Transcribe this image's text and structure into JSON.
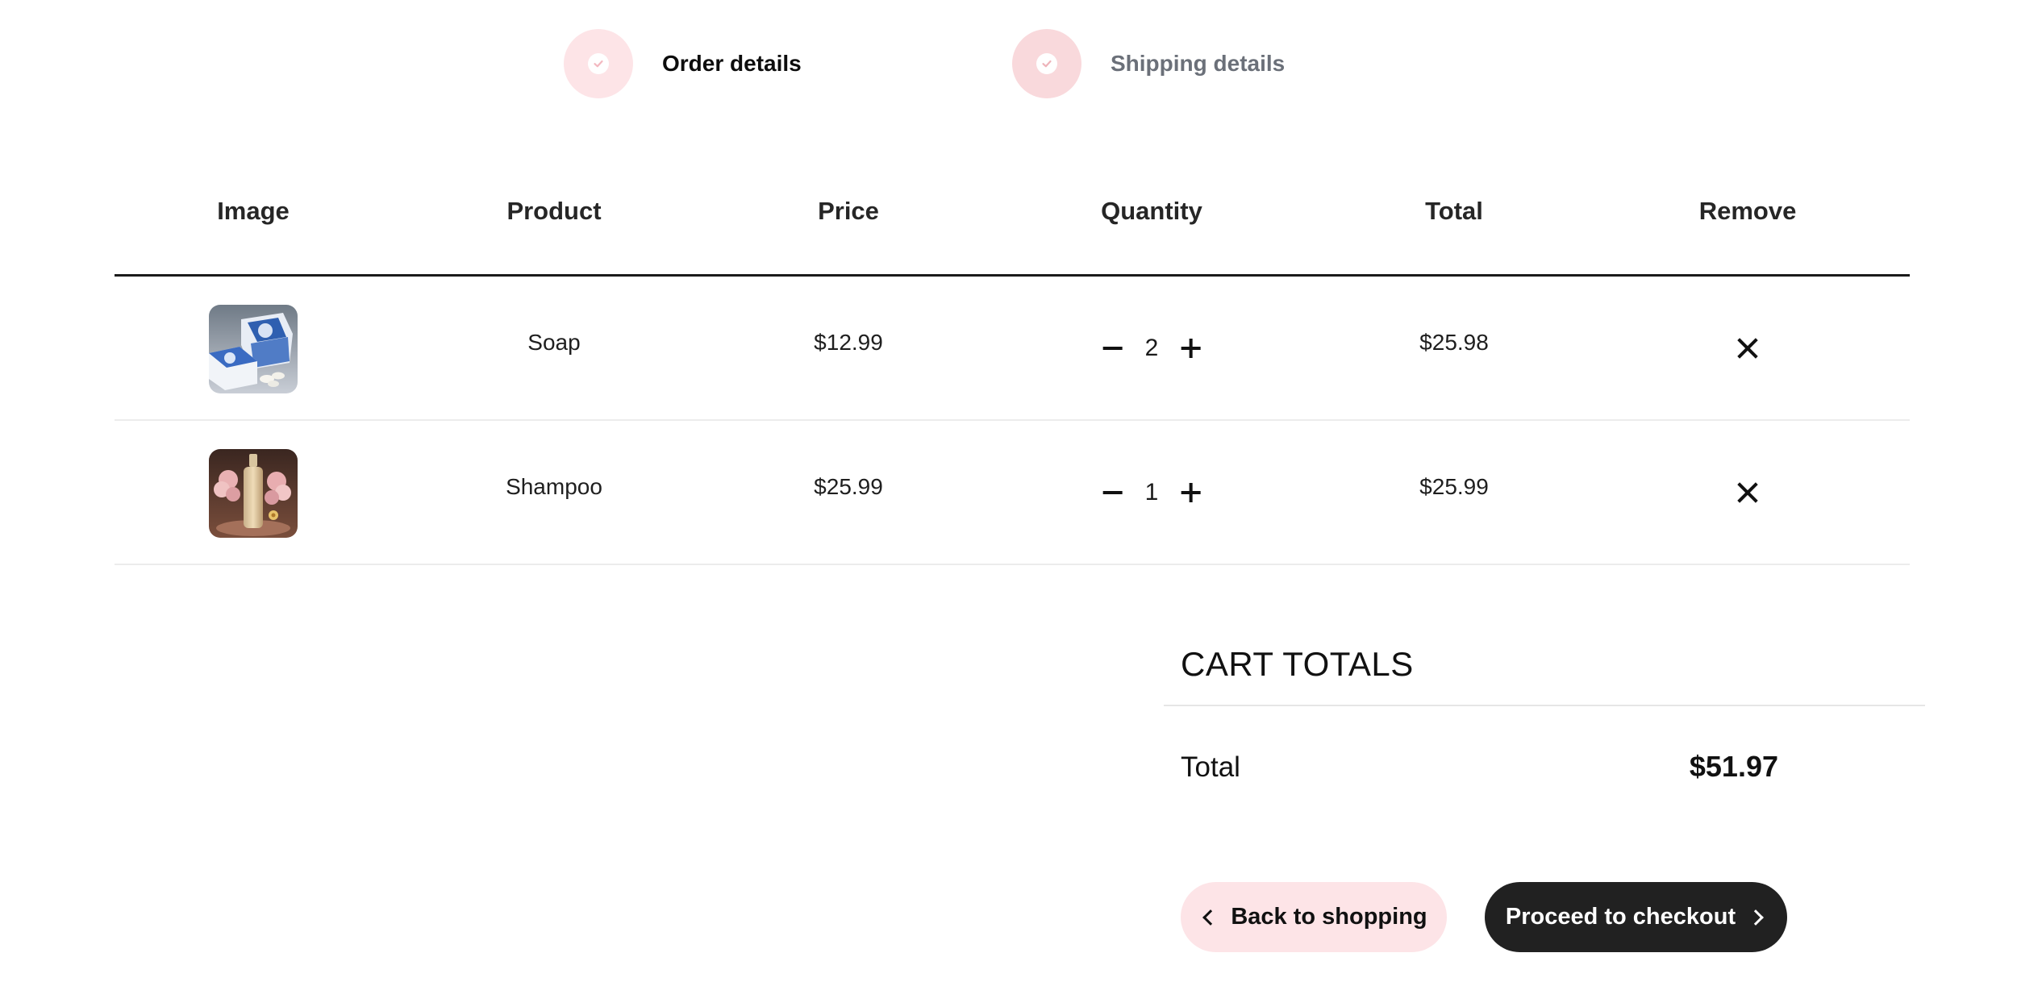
{
  "stepper": {
    "steps": [
      {
        "label": "Order details",
        "status": "complete"
      },
      {
        "label": "Shipping details",
        "status": "complete"
      }
    ]
  },
  "cart_table": {
    "headers": [
      "Image",
      "Product",
      "Price",
      "Quantity",
      "Total",
      "Remove"
    ],
    "rows": [
      {
        "image": "soap-image",
        "product": "Soap",
        "price": "$12.99",
        "quantity": "2",
        "total": "$25.98"
      },
      {
        "image": "shampoo-image",
        "product": "Shampoo",
        "price": "$25.99",
        "quantity": "1",
        "total": "$25.99"
      }
    ]
  },
  "cart_totals": {
    "title": "CART TOTALS",
    "total_label": "Total",
    "total_value": "$51.97"
  },
  "actions": {
    "back_label": "Back to shopping",
    "checkout_label": "Proceed to checkout"
  },
  "colors": {
    "accent_pink": "#fde4e7",
    "dark_button": "#212121",
    "divider": "#1a1a1a"
  }
}
